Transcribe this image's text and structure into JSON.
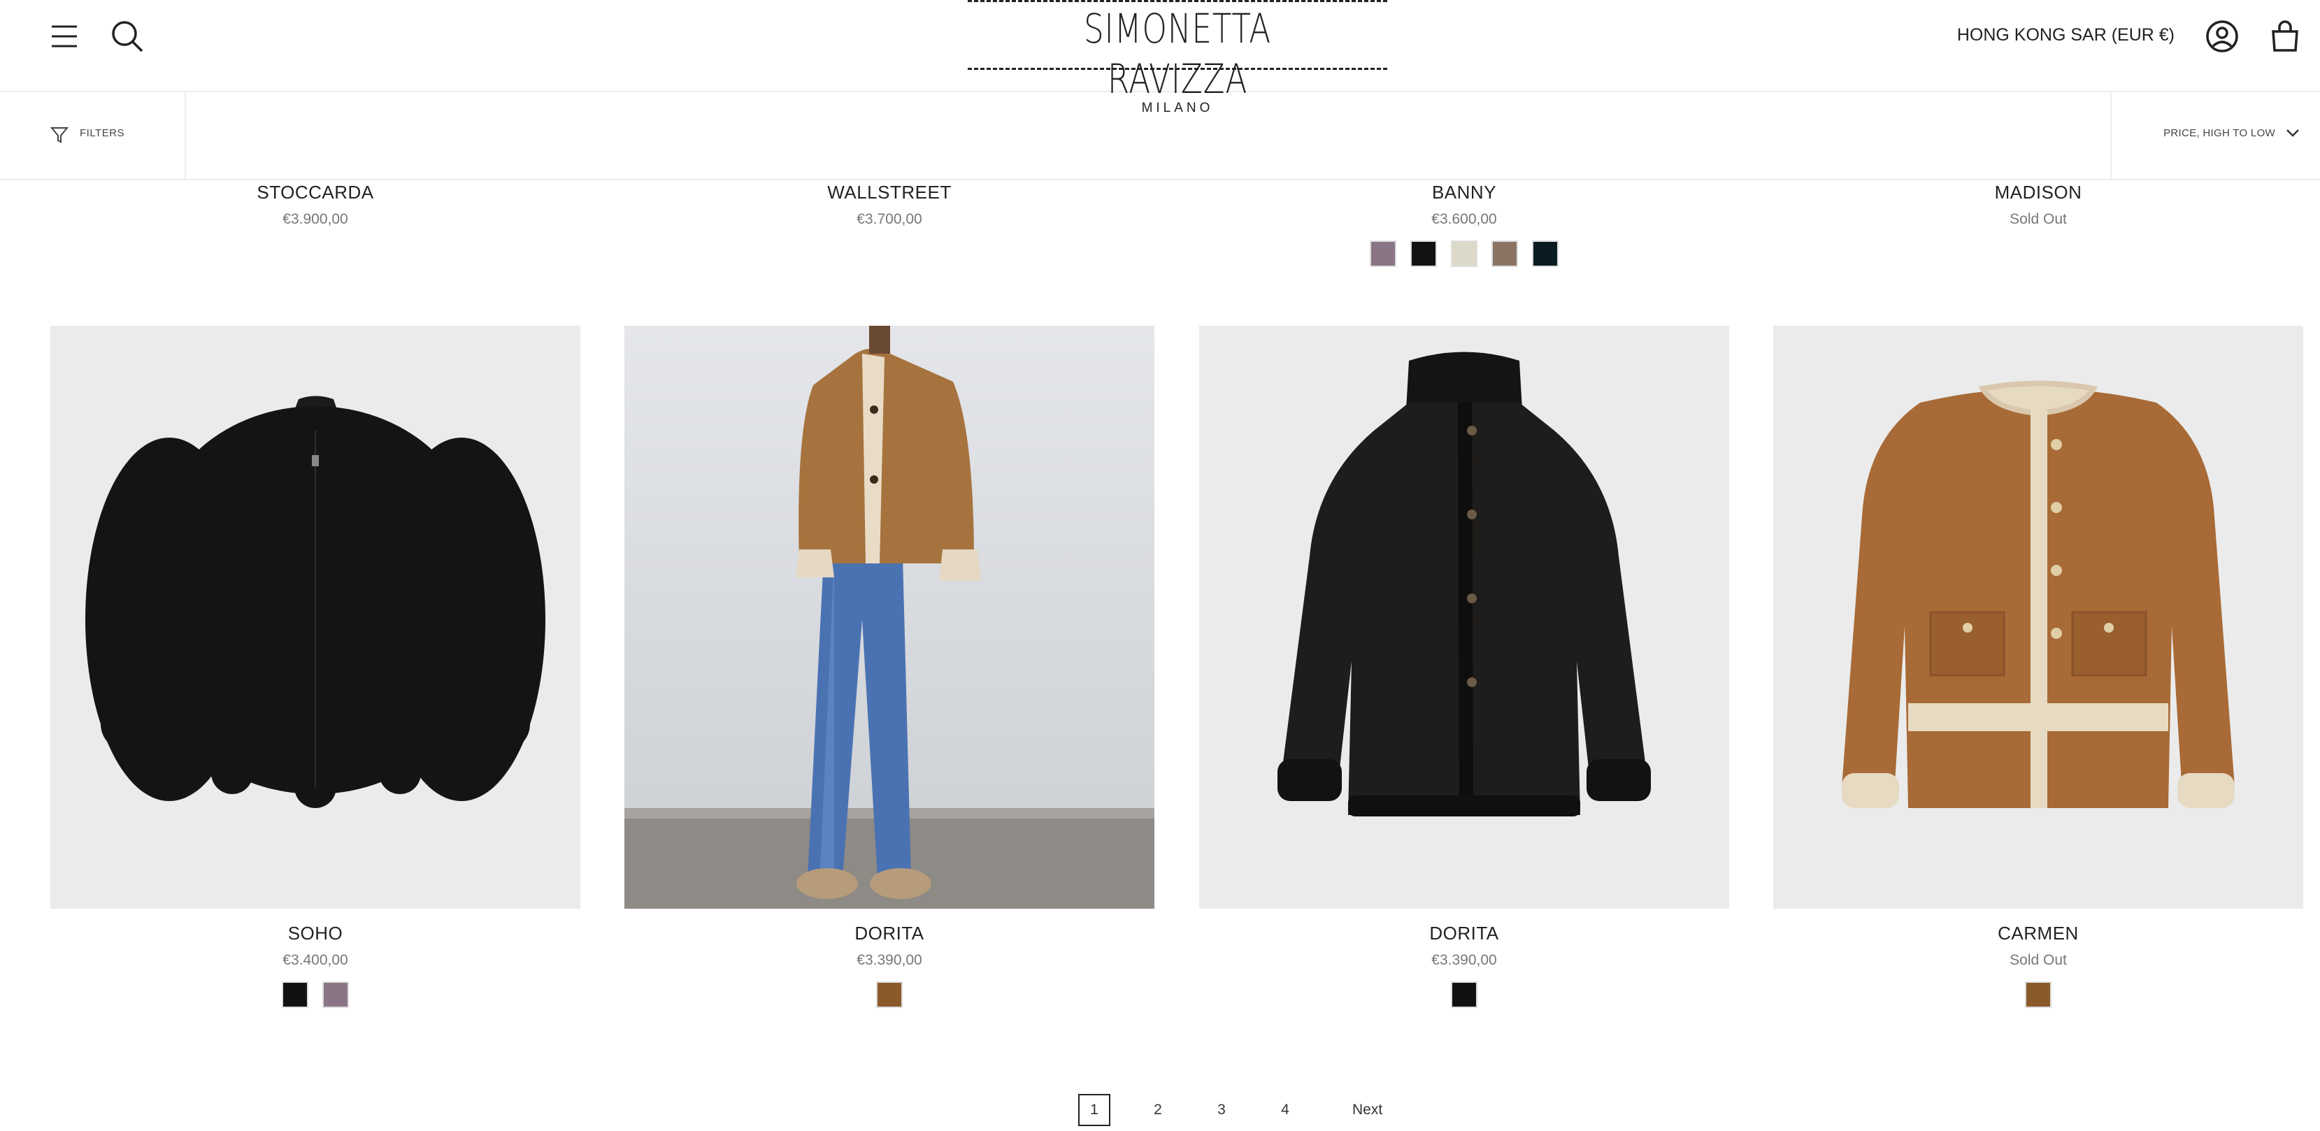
{
  "header": {
    "logo_main": "SIMONETTA RAVIZZA",
    "logo_sub": "MILANO",
    "region": "HONG KONG SAR (EUR €)",
    "icons": [
      "menu-icon",
      "search-icon",
      "account-icon",
      "cart-icon"
    ]
  },
  "toolbar": {
    "filters_label": "FILTERS",
    "sort_label": "PRICE, HIGH TO LOW"
  },
  "top_products": [
    {
      "name": "STOCCARDA",
      "price": "€3.900,00",
      "swatches": []
    },
    {
      "name": "WALLSTREET",
      "price": "€3.700,00",
      "swatches": []
    },
    {
      "name": "BANNY",
      "price": "€3.600,00",
      "swatches": [
        "#8a7586",
        "#121212",
        "#ddd9c8",
        "#8b7464",
        "#0a1c22"
      ]
    },
    {
      "name": "MADISON",
      "price": "Sold Out",
      "swatches": []
    }
  ],
  "products": [
    {
      "name": "SOHO",
      "price": "€3.400,00",
      "swatches": [
        "#111111",
        "#8a7586"
      ]
    },
    {
      "name": "DORITA",
      "price": "€3.390,00",
      "swatches": [
        "#8a5a2b"
      ]
    },
    {
      "name": "DORITA",
      "price": "€3.390,00",
      "swatches": [
        "#111111"
      ]
    },
    {
      "name": "CARMEN",
      "price": "Sold Out",
      "swatches": [
        "#8a5a2b"
      ]
    }
  ],
  "pagination": {
    "pages": [
      "1",
      "2",
      "3",
      "4"
    ],
    "current": "1",
    "next_label": "Next"
  },
  "colors": {
    "accent": "#222222",
    "price_text": "#777777",
    "image_bg": "#ebebeb"
  }
}
